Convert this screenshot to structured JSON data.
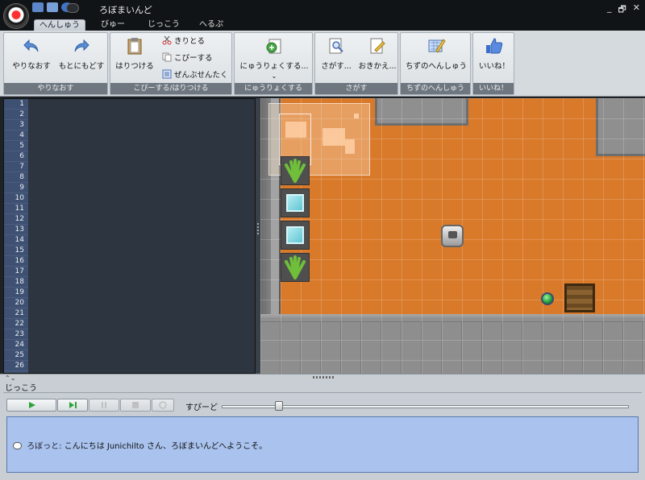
{
  "window": {
    "title": "ろぼまいんど",
    "controls": [
      "_",
      "🗗",
      "✕"
    ]
  },
  "tabs": [
    {
      "label": "へんしゅう",
      "active": true
    },
    {
      "label": "びゅー",
      "active": false
    },
    {
      "label": "じっこう",
      "active": false
    },
    {
      "label": "へるぷ",
      "active": false
    }
  ],
  "ribbon": {
    "undo_group": {
      "label": "やりなおす",
      "undo": "やりなおす",
      "redo": "もとにもどす"
    },
    "clipboard_group": {
      "label": "こぴーする/はりつける",
      "paste": "はりつける",
      "cut": "きりとる",
      "copy": "こぴーする",
      "select_all": "ぜんぶせんたく"
    },
    "import_group": {
      "label": "にゅうりょくする",
      "import": "にゅうりょくする..."
    },
    "search_group": {
      "label": "さがす",
      "find": "さがす...",
      "replace": "おきかえ..."
    },
    "map_group": {
      "label": "ちずのへんしゅう",
      "edit_map": "ちずのへんしゅう"
    },
    "like_group": {
      "label": "いいね！",
      "like": "いいね！"
    }
  },
  "editor": {
    "line_numbers": [
      "1",
      "2",
      "3",
      "4",
      "5",
      "6",
      "7",
      "8",
      "9",
      "10",
      "11",
      "12",
      "13",
      "14",
      "15",
      "16",
      "17",
      "18",
      "19",
      "20",
      "21",
      "22",
      "23",
      "24",
      "25",
      "26"
    ]
  },
  "run_panel": {
    "title": "じっこう",
    "speed_label": "すぴーど",
    "speed_value": 0.14
  },
  "message": {
    "speaker": "ろぼっと:",
    "text": "こんにちは Junichilto さん、ろぼまいんどへようこそ。"
  },
  "colors": {
    "floor": "#d9792a",
    "wall": "#8f8f8f",
    "accent": "#5778b0",
    "message_bg": "#a9c3ee",
    "gutter": "#3e5172"
  }
}
